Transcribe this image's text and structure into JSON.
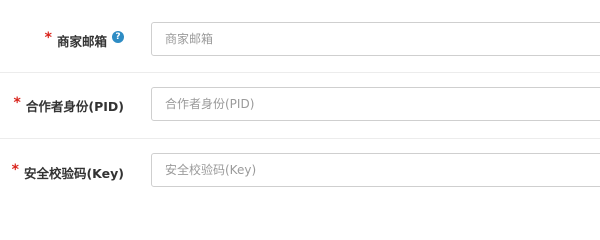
{
  "form": {
    "fields": [
      {
        "label": "商家邮箱",
        "required_mark": "*",
        "help_icon": "question-circle-icon",
        "help_glyph": "?",
        "placeholder": "商家邮箱",
        "value": ""
      },
      {
        "label": "合作者身份(PID)",
        "required_mark": "*",
        "placeholder": "合作者身份(PID)",
        "value": ""
      },
      {
        "label": "安全校验码(Key)",
        "required_mark": "*",
        "placeholder": "安全校验码(Key)",
        "value": ""
      }
    ]
  },
  "colors": {
    "required": "#d9231b",
    "help_icon": "#2e8cc4",
    "label_text": "#333333",
    "input_border": "#cfcfcf",
    "placeholder": "#9a9a9a",
    "divider": "#ececec"
  }
}
